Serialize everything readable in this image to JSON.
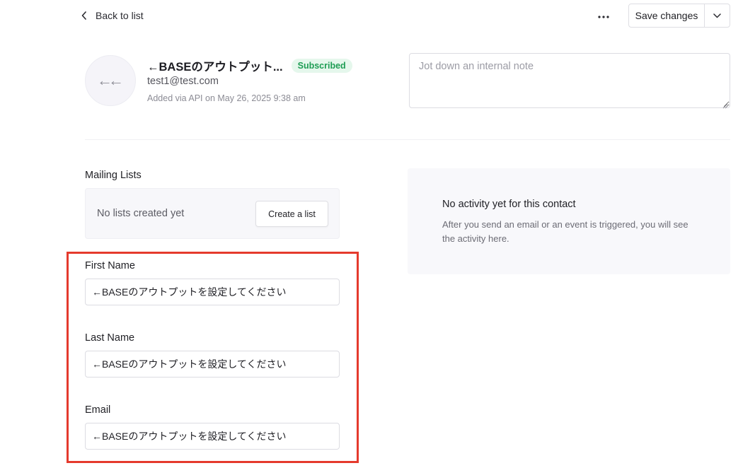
{
  "topbar": {
    "back_label": "Back to list",
    "save_label": "Save changes",
    "more_icon": "ellipsis-icon",
    "caret_icon": "chevron-down-icon"
  },
  "contact": {
    "avatar_text": "←←",
    "name": "←BASEのアウトプット...",
    "status": "Subscribed",
    "email": "test1@test.com",
    "added": "Added via API on May 26, 2025 9:38 am"
  },
  "note": {
    "placeholder": "Jot down an internal note"
  },
  "mailing_lists": {
    "title": "Mailing Lists",
    "empty_text": "No lists created yet",
    "create_label": "Create a list"
  },
  "activity": {
    "title": "No activity yet for this contact",
    "description": "After you send an email or an event is triggered, you will see the activity here."
  },
  "fields": {
    "first_name": {
      "label": "First Name",
      "value": "←BASEのアウトプットを設定してください"
    },
    "last_name": {
      "label": "Last Name",
      "value": "←BASEのアウトプットを設定してください"
    },
    "email": {
      "label": "Email",
      "value": "←BASEのアウトプットを設定してください"
    }
  },
  "colors": {
    "badge_text": "#1e9d54",
    "badge_bg": "#e5f7ec",
    "highlight_border": "#e53a2d"
  }
}
